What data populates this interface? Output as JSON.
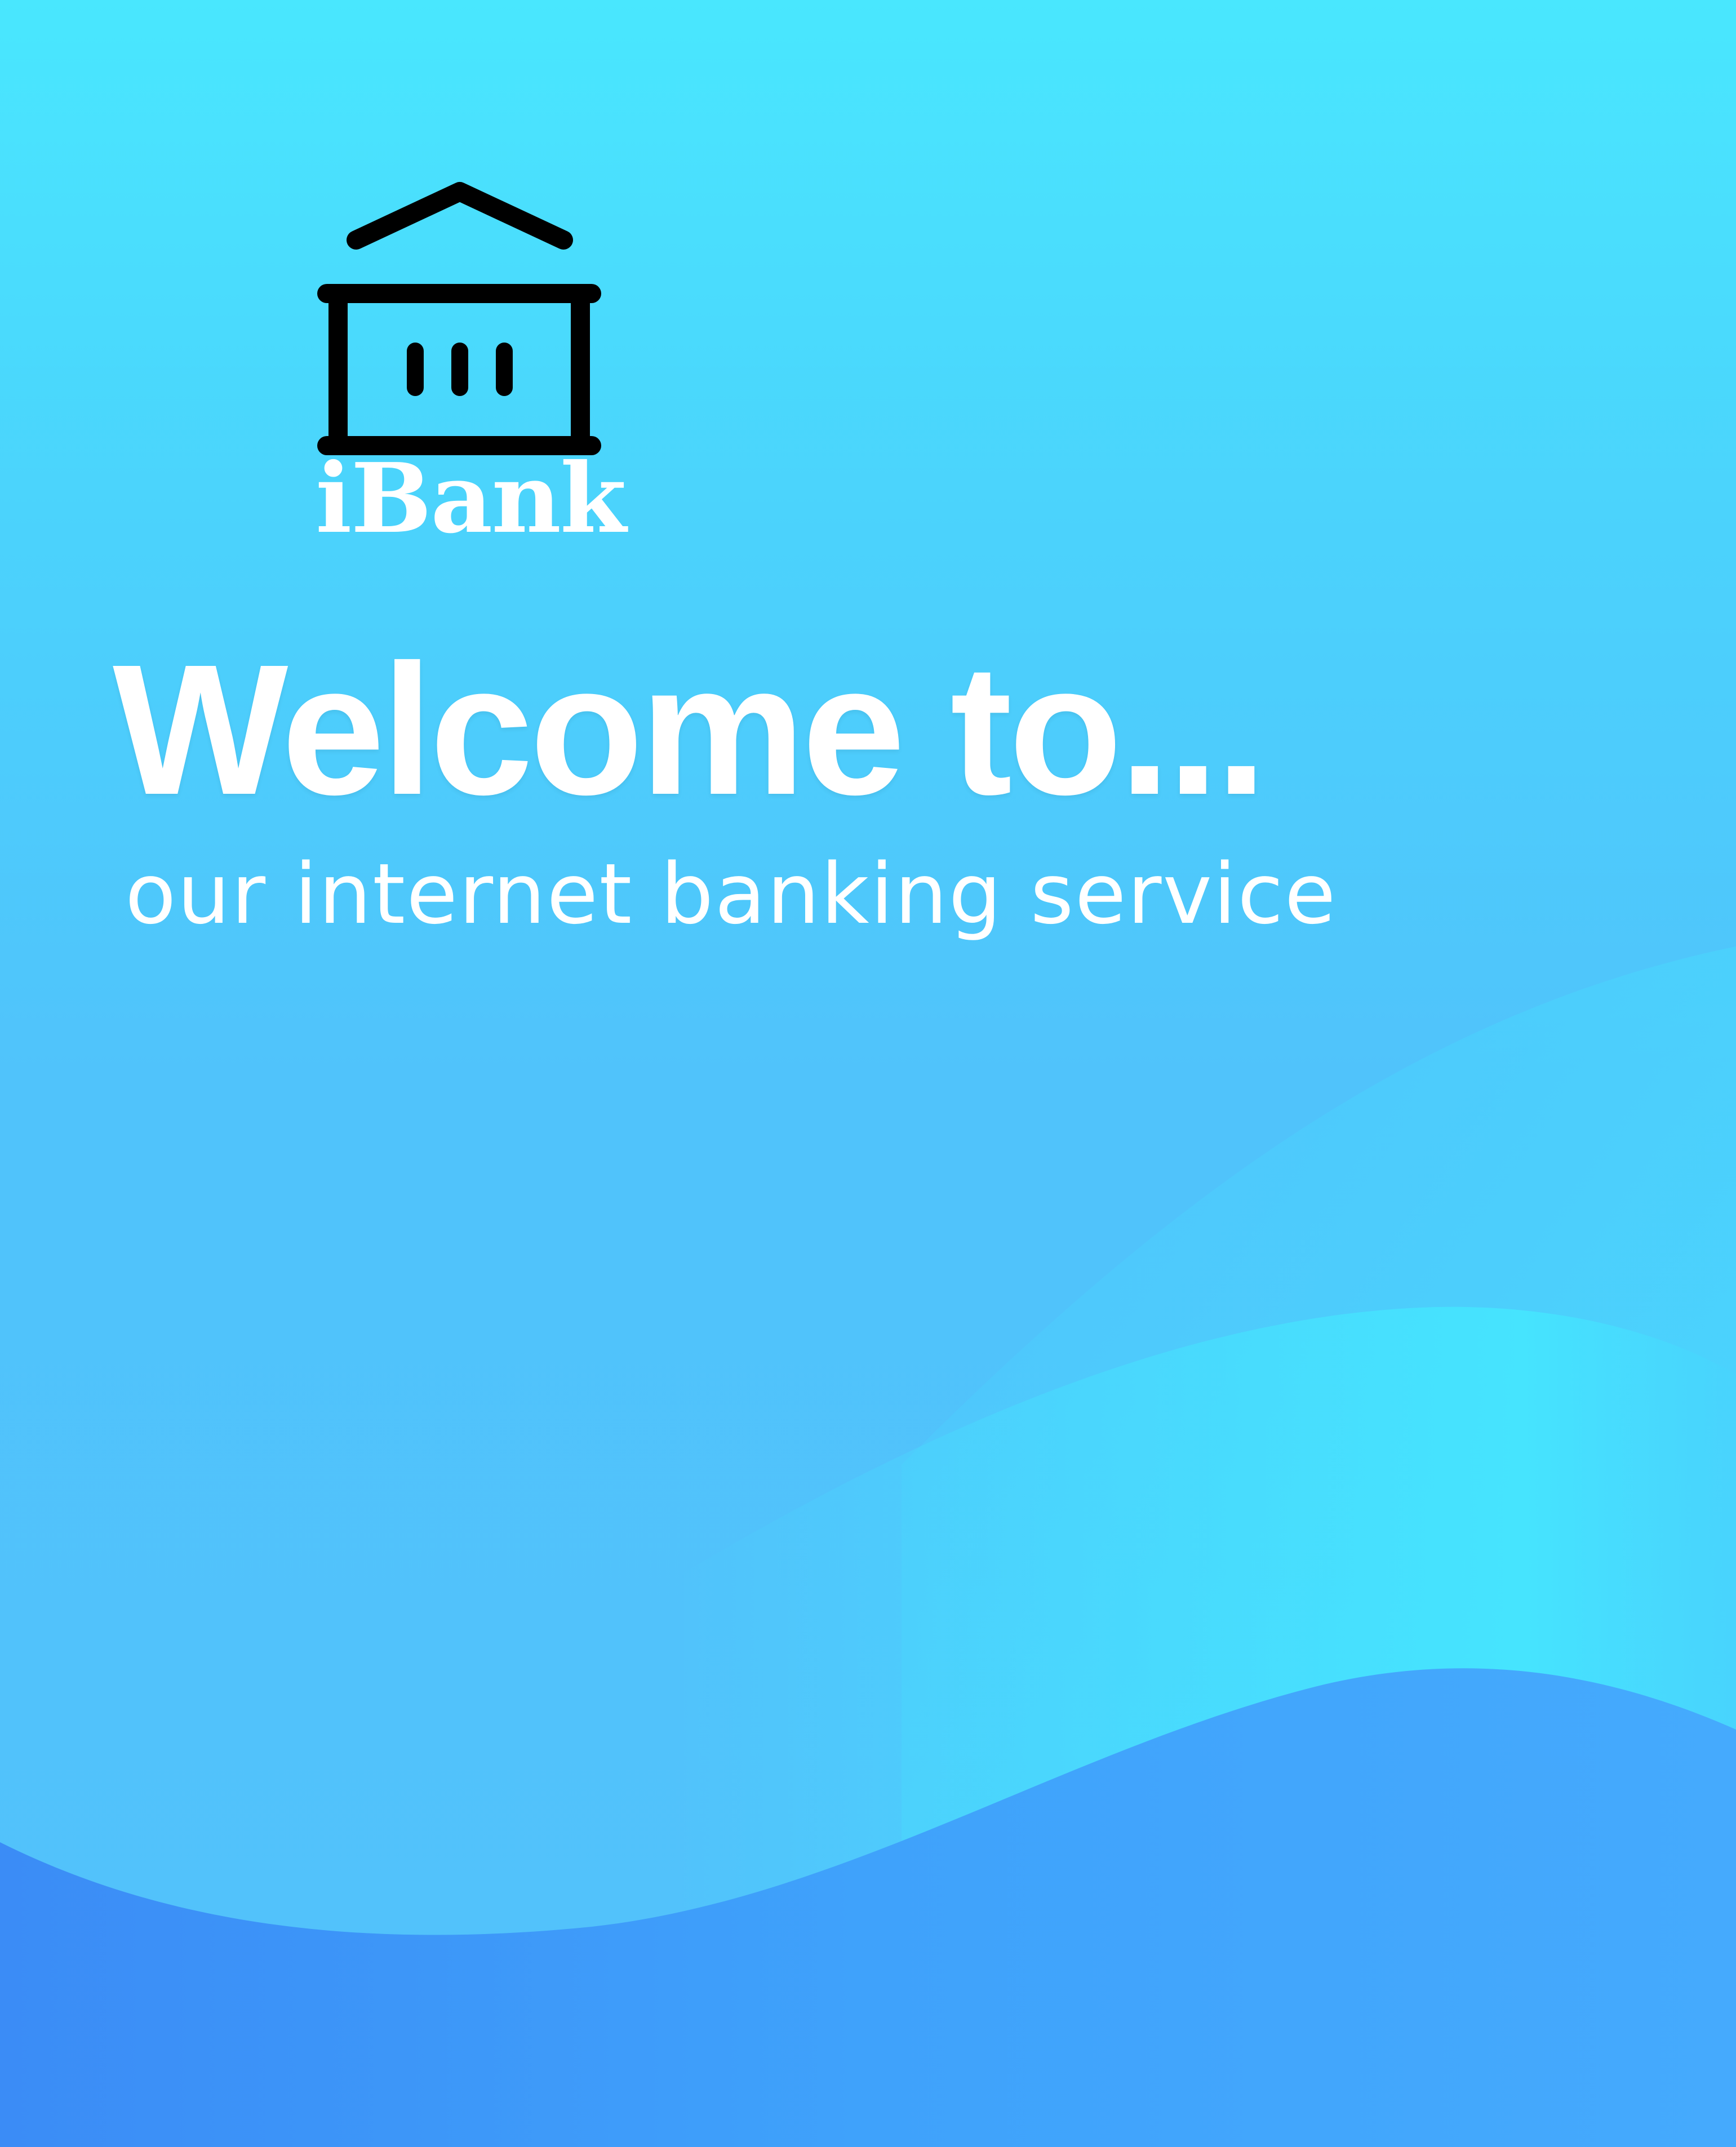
{
  "brand": {
    "logo_icon": "bank-building-icon",
    "name": "iBank"
  },
  "welcome": {
    "title": "Welcome to...",
    "subtitle": "our internet banking service"
  },
  "colors": {
    "background_top": "#49e7fe",
    "background_mid": "#50c3fb",
    "wave_light": "#45e3fe",
    "wave_dark": "#3f9ffb",
    "text": "#ffffff",
    "icon": "#000000"
  }
}
